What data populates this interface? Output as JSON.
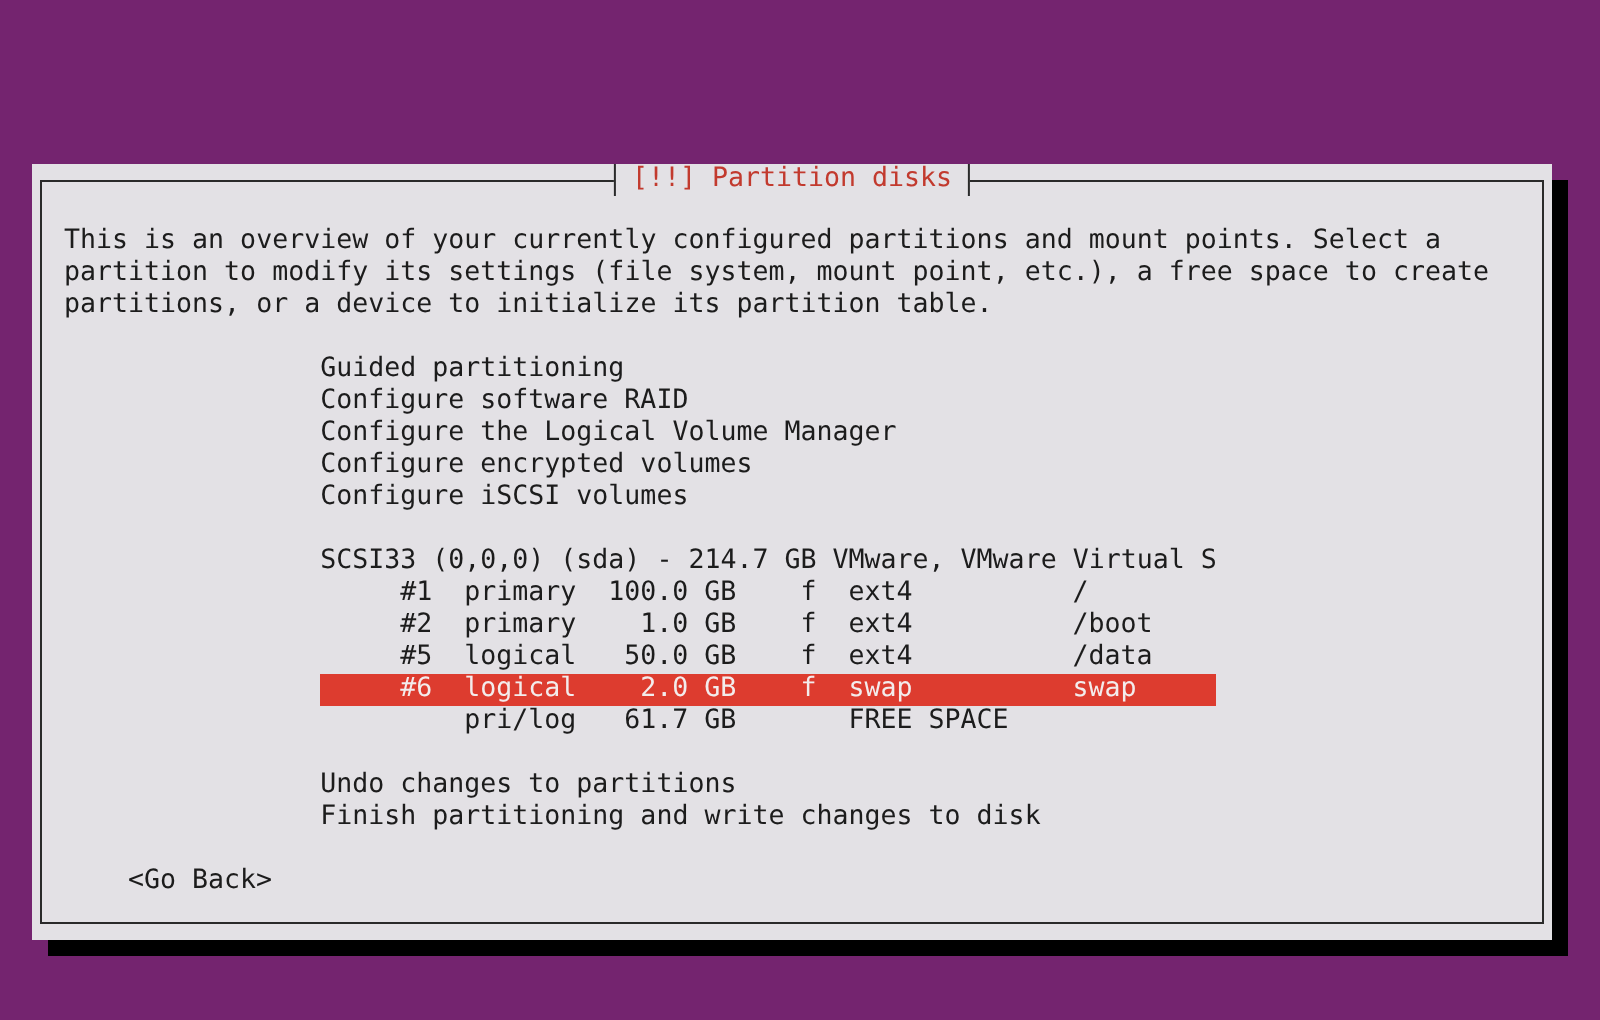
{
  "dialog": {
    "title": "[!!] Partition disks",
    "description": "This is an overview of your currently configured partitions and mount points. Select a partition to modify its settings (file system, mount point, etc.), a free space to create partitions, or a device to initialize its partition table.",
    "sections": [
      {
        "items": [
          {
            "kind": "action",
            "label": "Guided partitioning",
            "selected": false
          },
          {
            "kind": "action",
            "label": "Configure software RAID",
            "selected": false
          },
          {
            "kind": "action",
            "label": "Configure the Logical Volume Manager",
            "selected": false
          },
          {
            "kind": "action",
            "label": "Configure encrypted volumes",
            "selected": false
          },
          {
            "kind": "action",
            "label": "Configure iSCSI volumes",
            "selected": false
          }
        ]
      },
      {
        "items": [
          {
            "kind": "disk",
            "label": "SCSI33 (0,0,0) (sda) - 214.7 GB VMware, VMware Virtual S",
            "selected": false
          },
          {
            "kind": "partition",
            "number": "#1",
            "type": "primary",
            "size": "100.0 GB",
            "flag": "f",
            "filesystem": "ext4",
            "mount": "/",
            "selected": false
          },
          {
            "kind": "partition",
            "number": "#2",
            "type": "primary",
            "size": "1.0 GB",
            "flag": "f",
            "filesystem": "ext4",
            "mount": "/boot",
            "selected": false
          },
          {
            "kind": "partition",
            "number": "#5",
            "type": "logical",
            "size": "50.0 GB",
            "flag": "f",
            "filesystem": "ext4",
            "mount": "/data",
            "selected": false
          },
          {
            "kind": "partition",
            "number": "#6",
            "type": "logical",
            "size": "2.0 GB",
            "flag": "f",
            "filesystem": "swap",
            "mount": "swap",
            "selected": true
          },
          {
            "kind": "free",
            "type": "pri/log",
            "size": "61.7 GB",
            "filesystem": "FREE SPACE",
            "selected": false
          }
        ]
      },
      {
        "items": [
          {
            "kind": "action",
            "label": "Undo changes to partitions",
            "selected": false
          },
          {
            "kind": "action",
            "label": "Finish partitioning and write changes to disk",
            "selected": false
          }
        ]
      }
    ],
    "back_button": "<Go Back>"
  }
}
